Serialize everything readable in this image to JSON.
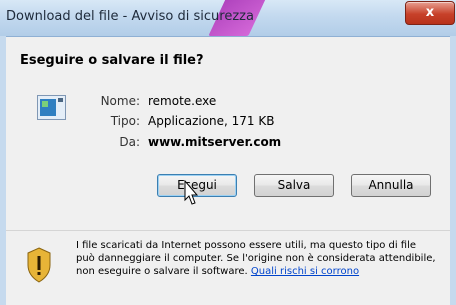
{
  "window": {
    "title": "Download del file - Avviso di sicurezza",
    "close_label": "x"
  },
  "dialog": {
    "heading": "Eseguire o salvare il file?",
    "file": {
      "name_label": "Nome:",
      "name_value": "remote.exe",
      "type_label": "Tipo:",
      "type_value": "Applicazione, 171 KB",
      "from_label": "Da:",
      "from_value": "www.mitserver.com"
    },
    "buttons": {
      "run": "Esegui",
      "save": "Salva",
      "cancel": "Annulla"
    },
    "warning": {
      "text": "I file scaricati da Internet possono essere utili, ma questo tipo di file può danneggiare il computer. Se l'origine non è considerata attendibile, non eseguire o salvare il software.",
      "link": "Quali rischi si corrono"
    }
  },
  "icons": {
    "file": "application-file-icon",
    "warning": "security-shield-icon",
    "cursor": "mouse-pointer-icon"
  },
  "colors": {
    "accent_ribbon": "#c050cc",
    "close_button": "#c7412a",
    "link": "#0044cc"
  }
}
